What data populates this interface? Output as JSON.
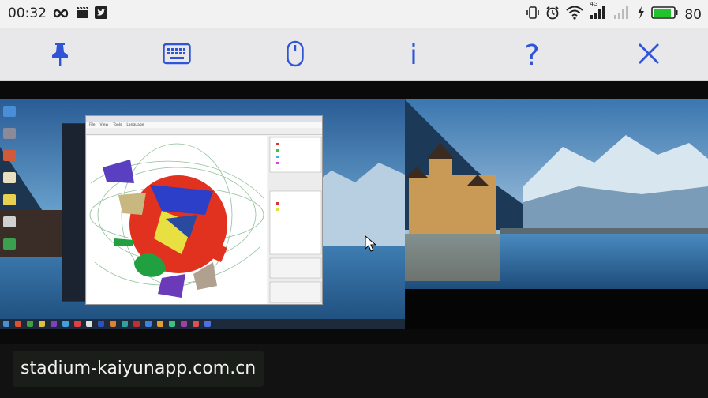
{
  "status_bar": {
    "time": "00:32",
    "battery_level": "80",
    "network_badge": "4G",
    "icons_left": [
      "infinity-icon",
      "clapperboard-icon",
      "twitter-icon"
    ],
    "icons_right": [
      "vibrate-icon",
      "alarm-icon",
      "wifi-icon",
      "signal-icon",
      "signal-weak-icon",
      "charging-icon",
      "battery-icon"
    ]
  },
  "toolbar": {
    "buttons": [
      {
        "name": "pin-button",
        "icon": "pin-icon"
      },
      {
        "name": "keyboard-button",
        "icon": "keyboard-icon"
      },
      {
        "name": "mouse-button",
        "icon": "mouse-icon"
      },
      {
        "name": "info-button",
        "icon": "info-icon",
        "label": "i"
      },
      {
        "name": "help-button",
        "icon": "help-icon",
        "label": "?"
      },
      {
        "name": "close-button",
        "icon": "close-icon"
      }
    ],
    "accent_color": "#2f54d6"
  },
  "remote_desktop": {
    "app_window_menu": [
      "File",
      "View",
      "Tools",
      "Language"
    ]
  },
  "footer": {
    "watermark": "stadium-kaiyunapp.com.cn"
  }
}
